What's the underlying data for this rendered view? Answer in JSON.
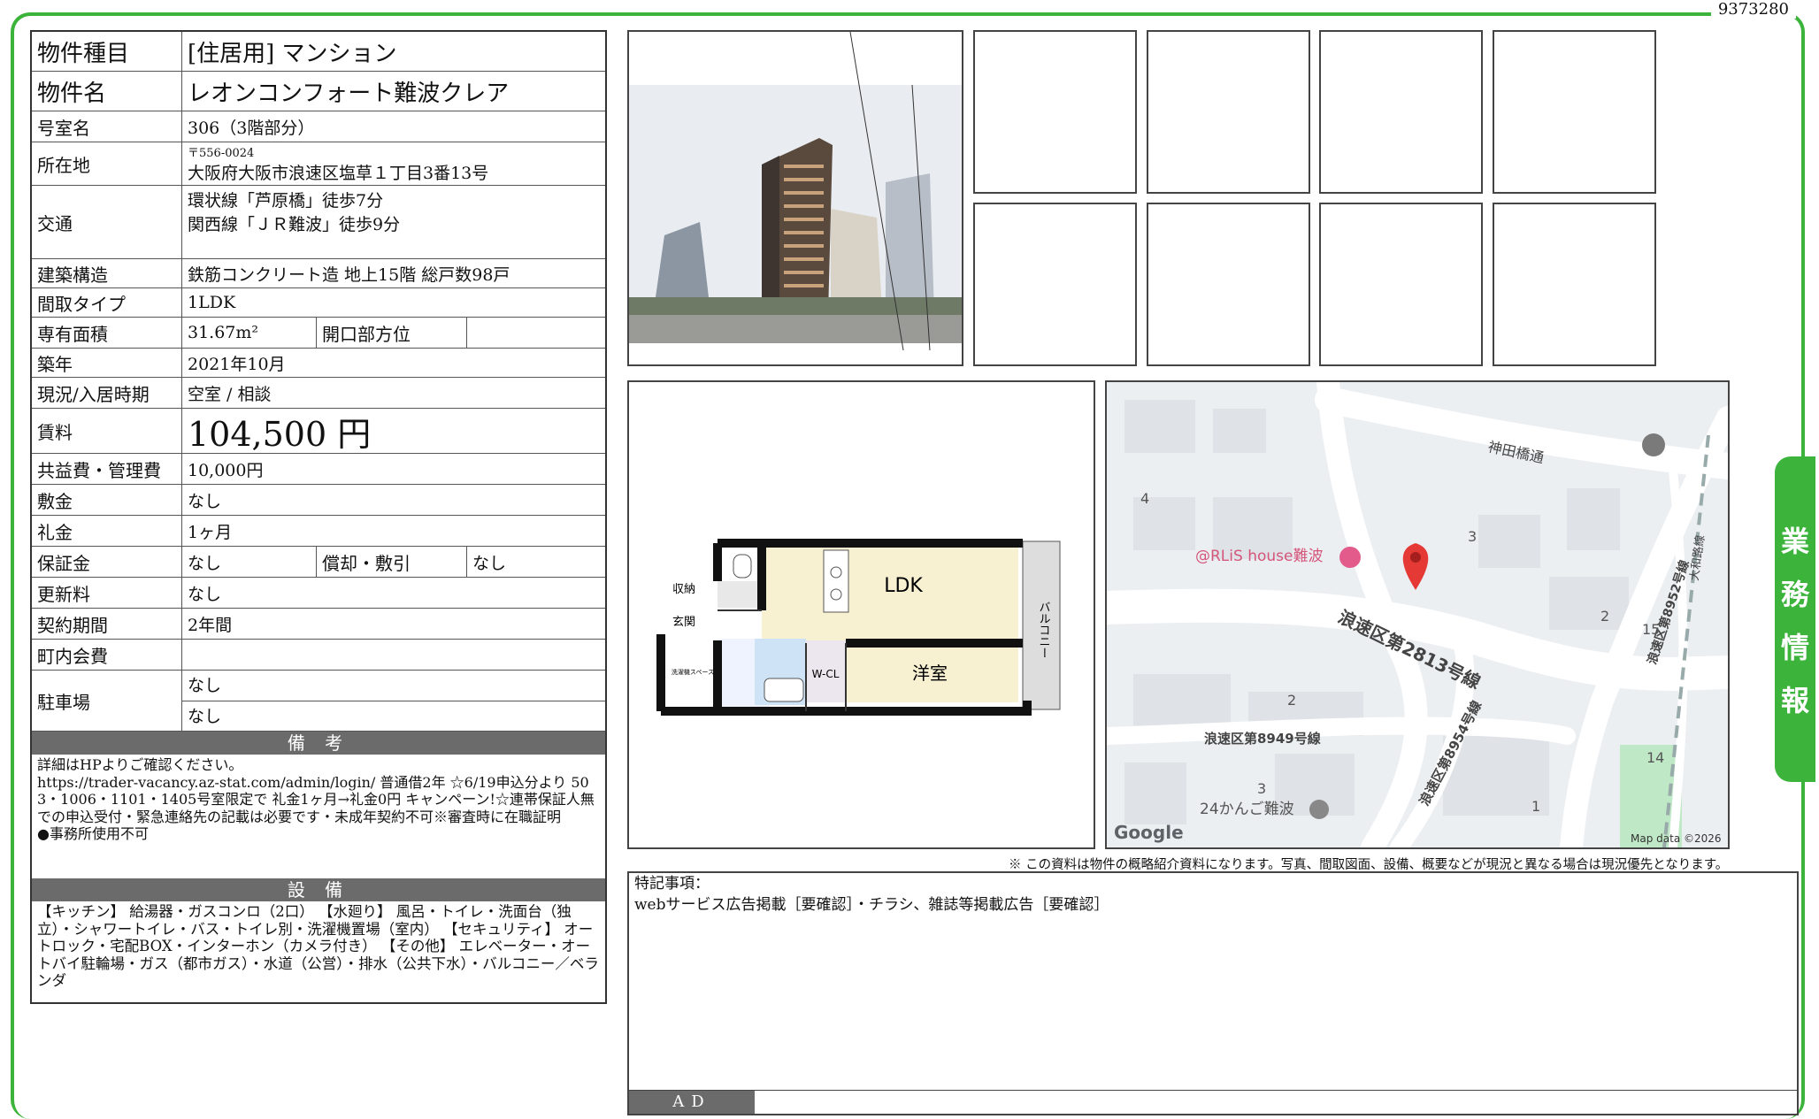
{
  "doc_id": "9373280",
  "side_tab": [
    "業",
    "務",
    "情",
    "報"
  ],
  "property": {
    "type_label": "物件種目",
    "type": "[住居用] マンション",
    "name_label": "物件名",
    "name": "レオンコンフォート難波クレア",
    "room_label": "号室名",
    "room": "306（3階部分）",
    "address_label": "所在地",
    "postal": "〒556-0024",
    "address": "大阪府大阪市浪速区塩草１丁目3番13号",
    "access_label": "交通",
    "access1": "環状線「芦原橋」徒歩7分",
    "access2": "関西線「ＪＲ難波」徒歩9分",
    "structure_label": "建築構造",
    "structure": "鉄筋コンクリート造 地上15階 総戸数98戸",
    "layout_label": "間取タイプ",
    "layout": "1LDK",
    "area_label": "専有面積",
    "area": "31.67m²",
    "direction_label": "開口部方位",
    "direction": "",
    "built_label": "築年",
    "built": "2021年10月",
    "status_label": "現況/入居時期",
    "status": "空室 / 相談",
    "rent_label": "賃料",
    "rent": "104,500 円",
    "fee_label": "共益費・管理費",
    "fee": "10,000円",
    "deposit_label": "敷金",
    "deposit": "なし",
    "keymoney_label": "礼金",
    "keymoney": "1ヶ月",
    "guarantee_label": "保証金",
    "guarantee": "なし",
    "amort_label": "償却・敷引",
    "amort": "なし",
    "renewal_label": "更新料",
    "renewal": "なし",
    "term_label": "契約期間",
    "term": "2年間",
    "community_label": "町内会費",
    "community": "",
    "parking_label": "駐車場",
    "parking1": "なし",
    "parking2": "なし"
  },
  "remarks": {
    "title": "備 考",
    "line1": "詳細はHPよりご確認ください。",
    "line2": "https://trader-vacancy.az-stat.com/admin/login/ 普通借2年 ☆6/19申込分より 503・1006・1101・1405号室限定で 礼金1ヶ月→礼金0円 キャンペーン!☆連帯保証人無での申込受付・緊急連絡先の記載は必要です・未成年契約不可※審査時に在職証明",
    "line3": "●事務所使用不可"
  },
  "equipment": {
    "title": "設 備",
    "text": "【キッチン】 給湯器・ガスコンロ（2口） 【水廻り】 風呂・トイレ・洗面台（独立）・シャワートイレ・バス・トイレ別・洗濯機置場（室内） 【セキュリティ】 オートロック・宅配BOX・インターホン（カメラ付き） 【その他】 エレベーター・オートバイ駐輪場・ガス（都市ガス）・水道（公営）・排水（公共下水）・バルコニー／ベランダ"
  },
  "floorplan": {
    "ldk": "LDK",
    "western": "洋室",
    "wcl": "W-CL",
    "storage": "収納",
    "entrance": "玄関",
    "balcony": "バルコニー",
    "laundry": "洗濯機スペース"
  },
  "map": {
    "road1": "神田橋通",
    "road2": "浪速区第2813号線",
    "road3": "浪速区第8949号線",
    "road4": "浪速区第8954号線",
    "road5": "浪速区第8952号線",
    "road6": "大和路線",
    "poi1": "@RLiS house難波",
    "poi2": "24かんご難波",
    "n1": "4",
    "n2": "3",
    "n3": "2",
    "n4": "2",
    "n5": "15",
    "n6": "3",
    "n7": "1",
    "n8": "14",
    "google": "Google",
    "mapdata": "Map data ©2026"
  },
  "disclaimer": "※ この資料は物件の概略紹介資料になります。写真、間取図面、設備、概要などが現況と異なる場合は現況優先となります。",
  "special": {
    "title": "特記事項：",
    "text": "webサービス広告掲載［要確認］・チラシ、雑誌等掲載広告［要確認］",
    "ad": "AD"
  }
}
